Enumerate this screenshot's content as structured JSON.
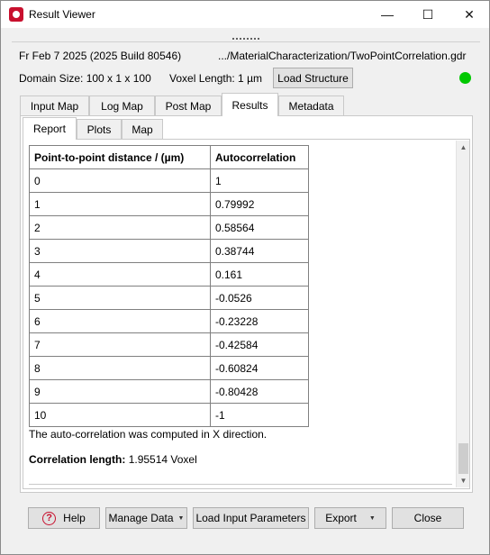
{
  "window": {
    "title": "Result Viewer",
    "minimize": "—",
    "maximize": "☐",
    "close": "✕"
  },
  "info": {
    "date_build": "Fr Feb 7 2025 (2025 Build 80546)",
    "path": ".../MaterialCharacterization/TwoPointCorrelation.gdr",
    "domain_size": "Domain Size: 100 x 1 x 100",
    "voxel_length": "Voxel Length: 1 µm",
    "load_structure": "Load Structure",
    "status_color": "#00c800"
  },
  "tabs": [
    "Input Map",
    "Log Map",
    "Post Map",
    "Results",
    "Metadata"
  ],
  "active_tab": "Results",
  "subtabs": [
    "Report",
    "Plots",
    "Map"
  ],
  "active_subtab": "Report",
  "report": {
    "headers": [
      "Point-to-point distance / (µm)",
      "Autocorrelation"
    ],
    "rows": [
      [
        "0",
        "1"
      ],
      [
        "1",
        "0.79992"
      ],
      [
        "2",
        "0.58564"
      ],
      [
        "3",
        "0.38744"
      ],
      [
        "4",
        "0.161"
      ],
      [
        "5",
        "-0.0526"
      ],
      [
        "6",
        "-0.23228"
      ],
      [
        "7",
        "-0.42584"
      ],
      [
        "8",
        "-0.60824"
      ],
      [
        "9",
        "-0.80428"
      ],
      [
        "10",
        "-1"
      ]
    ],
    "note": "The auto-correlation was computed in X direction.",
    "corr_label": "Correlation length:",
    "corr_value": "1.95514 Voxel"
  },
  "footer": {
    "help": "Help",
    "manage_data": "Manage Data",
    "load_input": "Load Input Parameters",
    "export": "Export",
    "close": "Close"
  },
  "icons": {
    "scroll_up": "▲",
    "scroll_down": "▼",
    "dropdown": "▼",
    "help": "?"
  }
}
